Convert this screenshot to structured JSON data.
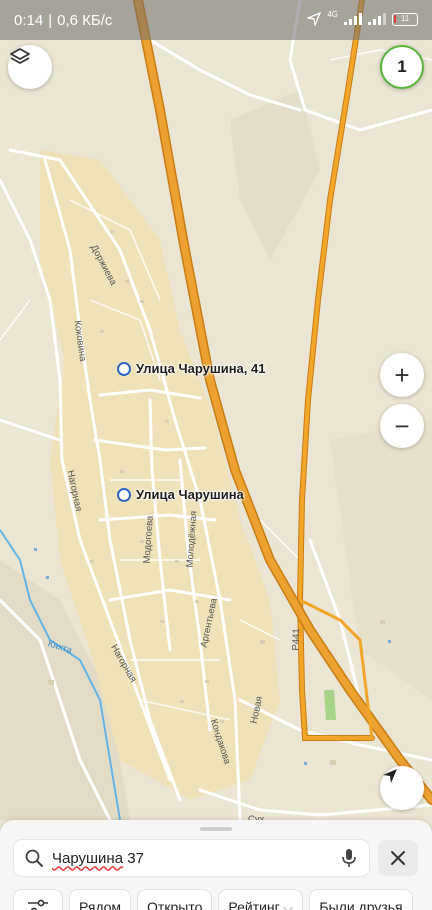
{
  "status_bar": {
    "time": "0:14",
    "speed": "0,6 КБ/с",
    "network": "4G",
    "battery": "11"
  },
  "map": {
    "controls": {
      "layers_icon": "layers-icon",
      "badge_count": "1",
      "zoom_in_label": "+",
      "zoom_out_label": "−",
      "location_icon": "navigation-arrow-icon"
    },
    "pins": [
      {
        "label": "Улица Чарушина, 41"
      },
      {
        "label": "Улица Чарушина"
      }
    ],
    "streets": {
      "dorzhieva": "Доржиева",
      "kokovina": "Коковина",
      "nagornaya_1": "Нагорная",
      "modogoeva": "Модогоева",
      "molodezhnaya": "Молодёжная",
      "argenteva": "Аргентьева",
      "nagornaya_2": "Нагорная",
      "kondakova": "Кондакова",
      "novaya": "Новая",
      "kyakhta": "Кяхта",
      "r441": "Р441",
      "sukh": "Сух"
    },
    "colors": {
      "highway": "#e89a1e",
      "highway_casing": "#c97c12",
      "settlement": "#ede0b6",
      "river": "#62b3e6",
      "pin": "#2f67c8"
    }
  },
  "search": {
    "query_underlined": "Чарушина",
    "query_rest": " 37",
    "mic_icon": "microphone-icon",
    "clear_icon": "close-icon"
  },
  "chips": {
    "filter_icon": "filter-icon",
    "items": [
      "Рядом",
      "Открыто",
      "Рейтинг",
      "Были друзья"
    ]
  }
}
